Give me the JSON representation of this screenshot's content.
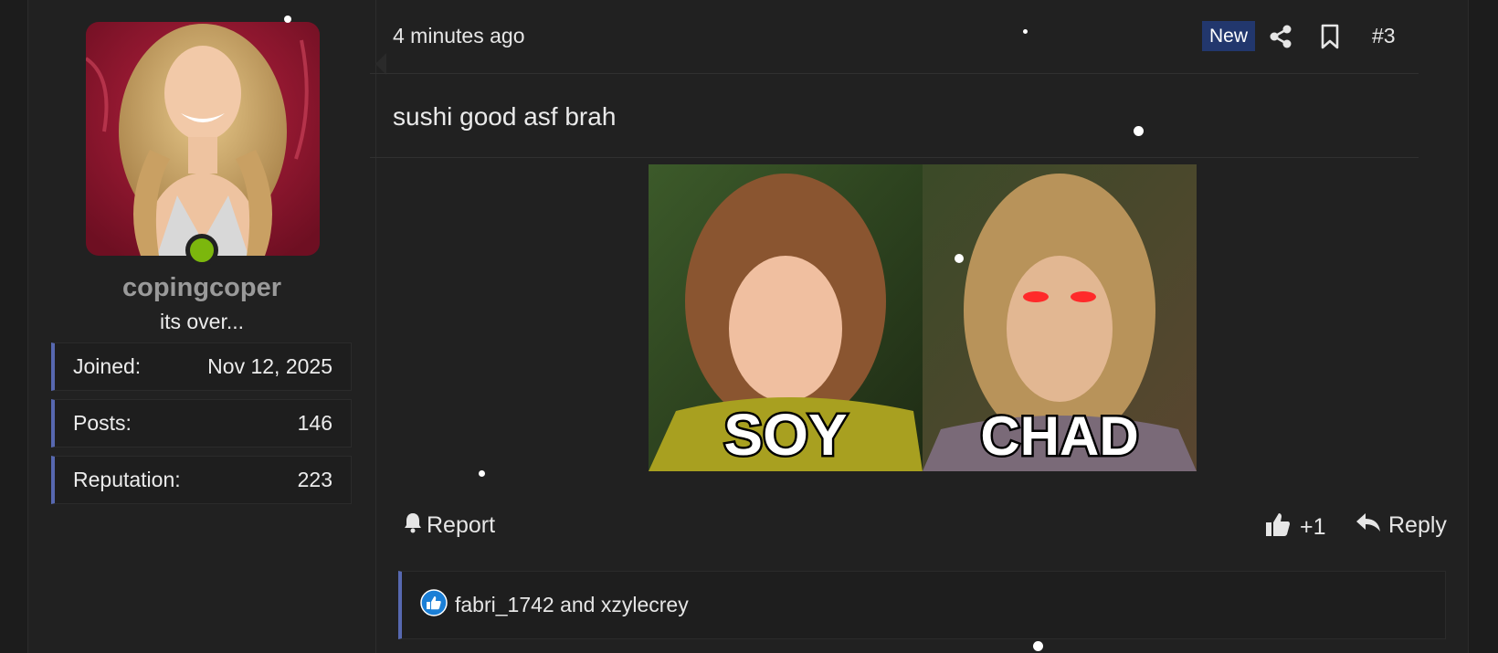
{
  "user": {
    "username": "copingcoper",
    "title": "its over...",
    "stats": [
      {
        "label": "Joined:",
        "value": "Nov 12, 2025"
      },
      {
        "label": "Posts:",
        "value": "146"
      },
      {
        "label": "Reputation:",
        "value": "223"
      }
    ]
  },
  "post": {
    "timestamp": "4 minutes ago",
    "badge": "New",
    "number": "#3",
    "text": "sushi good asf brah",
    "image_captions": [
      "SOY",
      "CHAD"
    ]
  },
  "actions": {
    "report": "Report",
    "like_count": "+1",
    "reply": "Reply"
  },
  "reactions": {
    "text": "fabri_1742 and xzylecrey"
  },
  "colors": {
    "accent": "#5768b0",
    "badge": "#22376d",
    "online": "#7cb70d",
    "like_blue": "#1b7fd6"
  }
}
